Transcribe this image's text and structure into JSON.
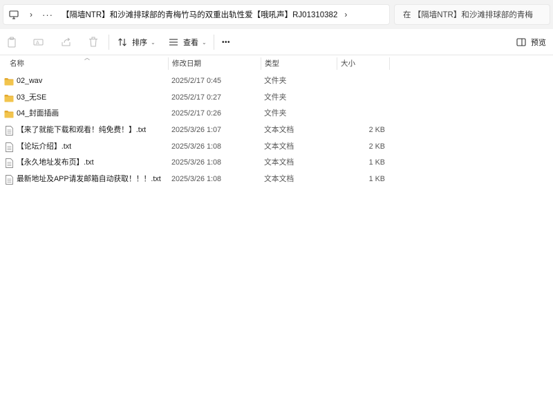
{
  "address": {
    "more": "···",
    "path": "【隔墙NTR】和沙滩排球部的青梅竹马的双重出轨性爱【哦吼声】RJ01310382"
  },
  "search": {
    "placeholder": "在 【隔墙NTR】和沙滩排球部的青梅"
  },
  "toolbar": {
    "sort_label": "排序",
    "view_label": "查看",
    "more_label": "•••",
    "preview_label": "预览"
  },
  "columns": {
    "name": "名称",
    "date": "修改日期",
    "type": "类型",
    "size": "大小"
  },
  "files": [
    {
      "icon": "folder-icon",
      "name": "02_wav",
      "date": "2025/2/17 0:45",
      "type": "文件夹",
      "size": ""
    },
    {
      "icon": "folder-icon",
      "name": "03_无SE",
      "date": "2025/2/17 0:27",
      "type": "文件夹",
      "size": ""
    },
    {
      "icon": "folder-icon",
      "name": "04_封面插画",
      "date": "2025/2/17 0:26",
      "type": "文件夹",
      "size": ""
    },
    {
      "icon": "text-file-icon",
      "name": "【来了就能下载和观看！纯免费！】.txt",
      "date": "2025/3/26 1:07",
      "type": "文本文档",
      "size": "2 KB"
    },
    {
      "icon": "text-file-icon",
      "name": "【论坛介绍】.txt",
      "date": "2025/3/26 1:08",
      "type": "文本文档",
      "size": "2 KB"
    },
    {
      "icon": "text-file-icon",
      "name": "【永久地址发布页】.txt",
      "date": "2025/3/26 1:08",
      "type": "文本文档",
      "size": "1 KB"
    },
    {
      "icon": "text-file-icon",
      "name": "最新地址及APP请发邮箱自动获取！！！.txt",
      "date": "2025/3/26 1:08",
      "type": "文本文档",
      "size": "1 KB"
    }
  ],
  "colors": {
    "folder": "#f2c44d",
    "folder_dark": "#e3a92e",
    "window_bg": "#f3f3f3"
  }
}
